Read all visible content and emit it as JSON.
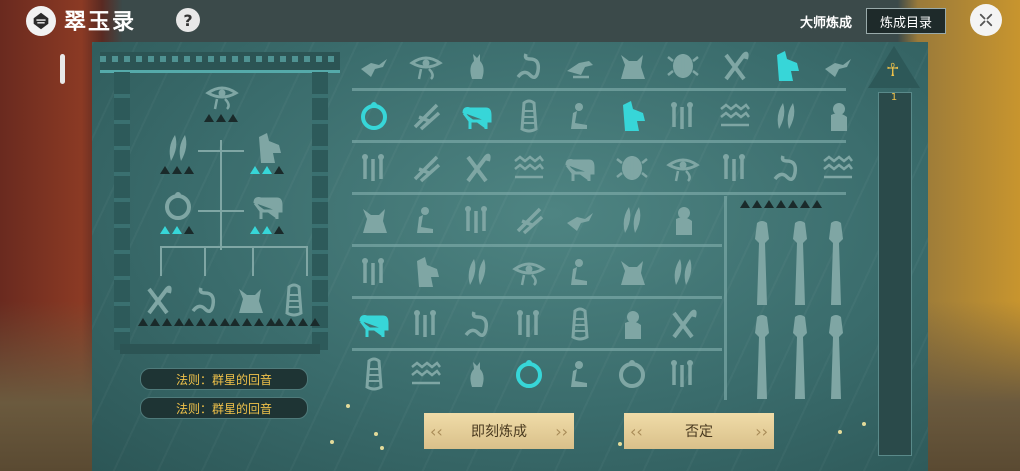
{
  "app": {
    "title": "翠玉录",
    "help_label": "?"
  },
  "header": {
    "master_label": "大师炼成",
    "catalog_label": "炼成目录"
  },
  "rules": [
    {
      "label": "法则：群星的回音"
    },
    {
      "label": "法则：群星的回音"
    }
  ],
  "actions": {
    "forge_label": "即刻炼成",
    "deny_label": "否定"
  },
  "scroll": {
    "page": "1"
  },
  "colors": {
    "lit": "#37d6d8",
    "dim": "#7fa6a4",
    "gold": "#f0c24a"
  },
  "grid": {
    "rows": [
      [
        "bird-icon",
        "eye-icon",
        "cat-icon",
        "snake-icon",
        "falcon-icon",
        "jackal-icon",
        "scarab-icon",
        "crook-icon",
        "anubis-icon",
        "bird-icon"
      ],
      [
        "ouroboros-icon",
        "reed-icon",
        "bull-icon",
        "mummy-icon",
        "seated-icon",
        "anubis-icon",
        "staff-icon",
        "water-icon",
        "feather-icon",
        "baboon-icon"
      ],
      [
        "staff-icon",
        "reed-icon",
        "crook-icon",
        "water-icon",
        "bull-icon",
        "scarab-icon",
        "eye-icon",
        "staff-icon",
        "snake-icon",
        "water-icon"
      ],
      [
        "jackal-icon",
        "seated-icon",
        "staff-icon",
        "reed-icon",
        "bird-icon",
        "feather-icon",
        "baboon-icon"
      ],
      [
        "staff-icon",
        "anubis-icon",
        "feather-icon",
        "eye-icon",
        "seated-icon",
        "jackal-icon",
        "feather-icon"
      ],
      [
        "bull-icon",
        "staff-icon",
        "snake-icon",
        "staff-icon",
        "mummy-icon",
        "baboon-icon",
        "crook-icon"
      ],
      [
        "mummy-icon",
        "water-icon",
        "cat-icon",
        "ouroboros-icon",
        "seated-icon",
        "ouroboros-icon",
        "staff-icon"
      ]
    ],
    "lit": [
      [
        0,
        8
      ],
      [
        1,
        0
      ],
      [
        1,
        2
      ],
      [
        1,
        5
      ],
      [
        5,
        0
      ],
      [
        6,
        3
      ]
    ]
  },
  "tree": {
    "top": "eye-icon",
    "mid": [
      "feather-icon",
      "anubis-icon"
    ],
    "low": [
      "ouroboros-icon",
      "bull-icon"
    ],
    "base": [
      "crook-icon",
      "snake-icon",
      "jackal-icon",
      "mummy-icon"
    ]
  }
}
